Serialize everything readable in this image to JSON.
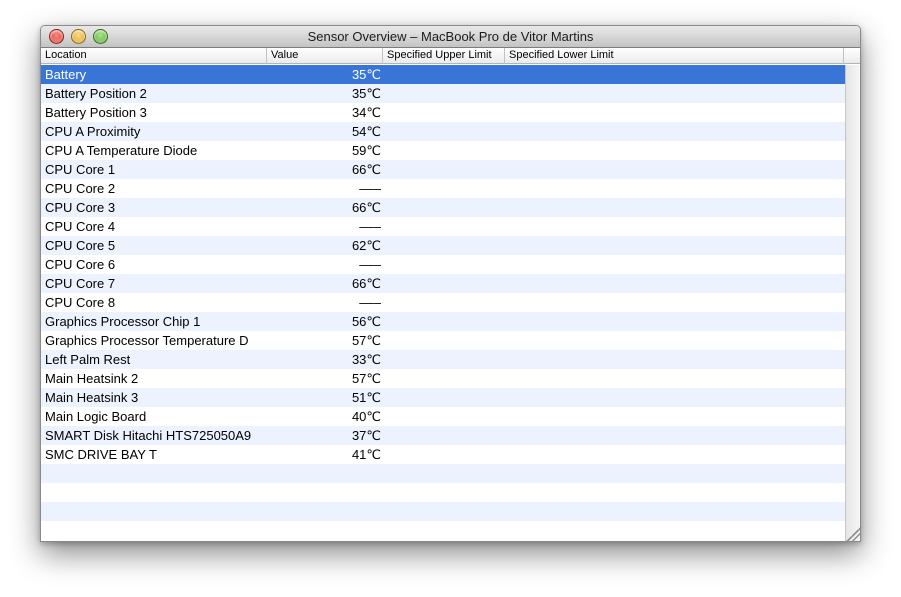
{
  "window": {
    "title": "Sensor Overview – MacBook Pro de Vitor Martins"
  },
  "columns": {
    "location": "Location",
    "value": "Value",
    "upper": "Specified Upper Limit",
    "lower": "Specified Lower Limit"
  },
  "selected_row": 0,
  "rows": [
    {
      "location": "Battery",
      "value": "35℃"
    },
    {
      "location": "Battery Position 2",
      "value": "35℃"
    },
    {
      "location": "Battery Position 3",
      "value": "34℃"
    },
    {
      "location": "CPU A Proximity",
      "value": "54℃"
    },
    {
      "location": "CPU A Temperature Diode",
      "value": "59℃"
    },
    {
      "location": "CPU Core 1",
      "value": "66℃"
    },
    {
      "location": "CPU Core 2",
      "value": "–––"
    },
    {
      "location": "CPU Core 3",
      "value": "66℃"
    },
    {
      "location": "CPU Core 4",
      "value": "–––"
    },
    {
      "location": "CPU Core 5",
      "value": "62℃"
    },
    {
      "location": "CPU Core 6",
      "value": "–––"
    },
    {
      "location": "CPU Core 7",
      "value": "66℃"
    },
    {
      "location": "CPU Core 8",
      "value": "–––"
    },
    {
      "location": "Graphics Processor Chip 1",
      "value": "56℃"
    },
    {
      "location": "Graphics Processor Temperature D",
      "value": "57℃"
    },
    {
      "location": "Left Palm Rest",
      "value": "33℃"
    },
    {
      "location": "Main Heatsink 2",
      "value": "57℃"
    },
    {
      "location": "Main Heatsink 3",
      "value": "51℃"
    },
    {
      "location": "Main Logic Board",
      "value": "40℃"
    },
    {
      "location": "SMART Disk Hitachi HTS725050A9",
      "value": "37℃"
    },
    {
      "location": "SMC DRIVE BAY T",
      "value": "41℃"
    }
  ],
  "empty_rows": 3,
  "colors": {
    "selection": "#3875d7",
    "alternate_row": "#edf3fe"
  }
}
